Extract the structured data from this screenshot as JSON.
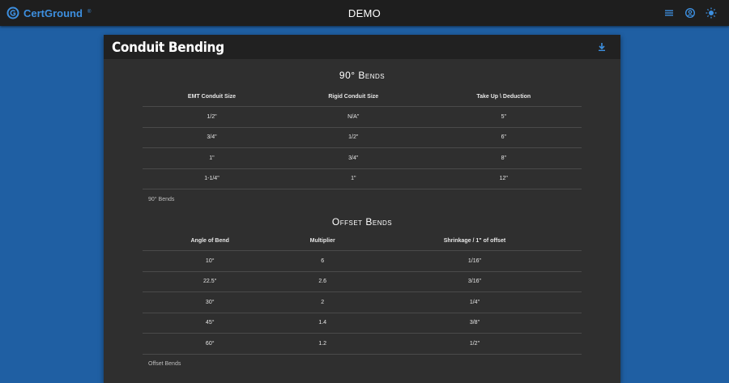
{
  "app": {
    "brand": "CertGround",
    "brand_mark": "®",
    "title": "DEMO"
  },
  "icons": {
    "menu": "menu-icon",
    "account": "account-circle-icon",
    "theme": "brightness-icon",
    "download": "download-icon",
    "logo": "certground-logo-icon"
  },
  "colors": {
    "page_bg": "#1f5fa3",
    "accent": "#3d8fdf",
    "topbar_bg": "#1e1e1e",
    "card_bg": "#2f2f2f"
  },
  "card": {
    "title": "Conduit Bending"
  },
  "bends90": {
    "title": "90° Bends",
    "headers": [
      "EMT Conduit Size",
      "Rigid Conduit Size",
      "Take Up \\ Deduction"
    ],
    "rows": [
      [
        "1/2\"",
        "N/A\"",
        "5\""
      ],
      [
        "3/4\"",
        "1/2\"",
        "6\""
      ],
      [
        "1\"",
        "3/4\"",
        "8\""
      ],
      [
        "1-1/4\"",
        "1\"",
        "12\""
      ]
    ],
    "caption": "90° Bends"
  },
  "offset": {
    "title": "Offset Bends",
    "headers": [
      "Angle of Bend",
      "Multiplier",
      "Shrinkage / 1\" of offset"
    ],
    "rows": [
      [
        "10°",
        "6",
        "1/16\""
      ],
      [
        "22.5°",
        "2.6",
        "3/16\""
      ],
      [
        "30°",
        "2",
        "1/4\""
      ],
      [
        "45°",
        "1.4",
        "3/8\""
      ],
      [
        "60°",
        "1.2",
        "1/2\""
      ]
    ],
    "caption": "Offset Bends"
  }
}
